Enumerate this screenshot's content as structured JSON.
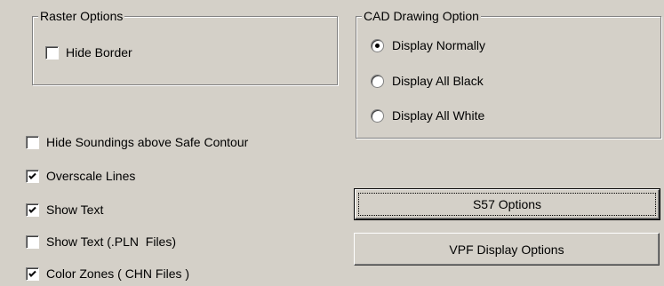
{
  "raster_options": {
    "title": "Raster Options",
    "hide_border": {
      "label": "Hide Border",
      "checked": false
    }
  },
  "cad_drawing_option": {
    "title": "CAD Drawing Option",
    "options": [
      {
        "label": "Display Normally",
        "selected": true
      },
      {
        "label": "Display All Black",
        "selected": false
      },
      {
        "label": "Display All White",
        "selected": false
      }
    ]
  },
  "checkboxes": [
    {
      "label": "Hide Soundings above Safe Contour",
      "checked": false
    },
    {
      "label": "Overscale Lines",
      "checked": true
    },
    {
      "label": "Show Text",
      "checked": true
    },
    {
      "label": "Show Text (.PLN  Files)",
      "checked": false
    },
    {
      "label": "Color Zones ( CHN Files )",
      "checked": true
    }
  ],
  "buttons": {
    "s57_options": "S57 Options",
    "vpf_display_options": "VPF Display Options"
  }
}
